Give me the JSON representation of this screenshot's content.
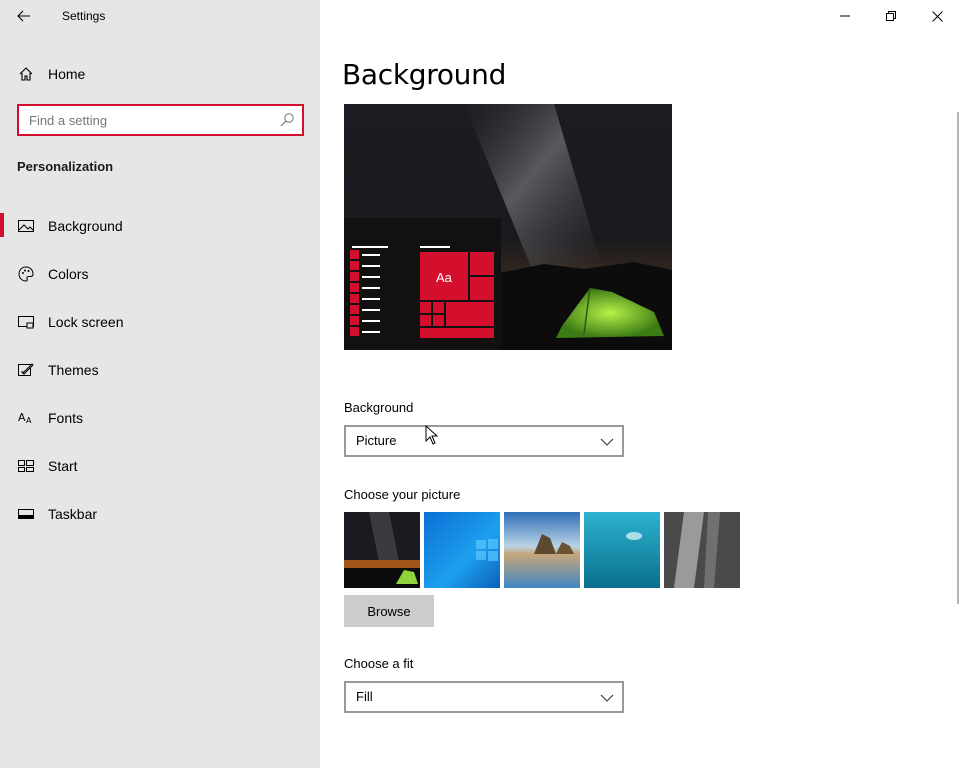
{
  "window": {
    "title": "Settings"
  },
  "sidebar": {
    "home_label": "Home",
    "search_placeholder": "Find a setting",
    "section_title": "Personalization",
    "items": [
      {
        "label": "Background",
        "icon": "picture-icon",
        "active": true
      },
      {
        "label": "Colors",
        "icon": "palette-icon",
        "active": false
      },
      {
        "label": "Lock screen",
        "icon": "lock-screen-icon",
        "active": false
      },
      {
        "label": "Themes",
        "icon": "themes-icon",
        "active": false
      },
      {
        "label": "Fonts",
        "icon": "fonts-icon",
        "active": false
      },
      {
        "label": "Start",
        "icon": "start-icon",
        "active": false
      },
      {
        "label": "Taskbar",
        "icon": "taskbar-icon",
        "active": false
      }
    ]
  },
  "main": {
    "title": "Background",
    "preview": {
      "sample_text": "Aa",
      "accent_color": "#d40f2e"
    },
    "background_label": "Background",
    "background_value": "Picture",
    "choose_picture_label": "Choose your picture",
    "browse_label": "Browse",
    "fit_label": "Choose a fit",
    "fit_value": "Fill"
  },
  "colors": {
    "accent": "#d40f2e",
    "sidebar_bg": "#e6e6e6"
  }
}
